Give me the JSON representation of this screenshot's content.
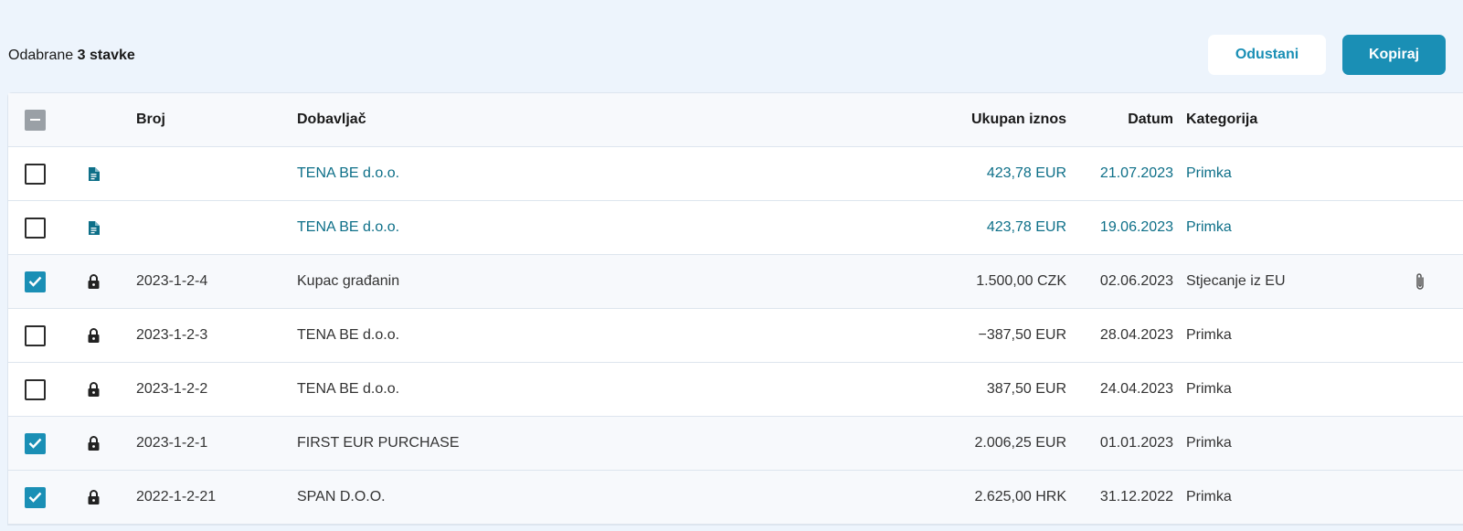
{
  "selection": {
    "prefix": "Odabrane",
    "count_label": "3 stavke"
  },
  "actions": {
    "cancel_label": "Odustani",
    "copy_label": "Kopiraj"
  },
  "colors": {
    "accent": "#1a8fb5",
    "link": "#0d6f88",
    "background": "#edf4fc"
  },
  "table": {
    "header_checkbox_state": "indeterminate",
    "columns": {
      "broj": "Broj",
      "dobavljac": "Dobavljač",
      "iznos": "Ukupan iznos",
      "datum": "Datum",
      "kategorija": "Kategorija"
    },
    "rows": [
      {
        "checked": false,
        "icon": "document-icon",
        "broj": "",
        "dobavljac": "TENA BE d.o.o.",
        "iznos": "423,78 EUR",
        "datum": "21.07.2023",
        "kategorija": "Primka",
        "draft": true,
        "attachment": false
      },
      {
        "checked": false,
        "icon": "document-icon",
        "broj": "",
        "dobavljac": "TENA BE d.o.o.",
        "iznos": "423,78 EUR",
        "datum": "19.06.2023",
        "kategorija": "Primka",
        "draft": true,
        "attachment": false
      },
      {
        "checked": true,
        "icon": "lock-icon",
        "broj": "2023-1-2-4",
        "dobavljac": "Kupac građanin",
        "iznos": "1.500,00 CZK",
        "datum": "02.06.2023",
        "kategorija": "Stjecanje iz EU",
        "draft": false,
        "attachment": true
      },
      {
        "checked": false,
        "icon": "lock-icon",
        "broj": "2023-1-2-3",
        "dobavljac": "TENA BE d.o.o.",
        "iznos": "−387,50 EUR",
        "datum": "28.04.2023",
        "kategorija": "Primka",
        "draft": false,
        "attachment": false
      },
      {
        "checked": false,
        "icon": "lock-icon",
        "broj": "2023-1-2-2",
        "dobavljac": "TENA BE d.o.o.",
        "iznos": "387,50 EUR",
        "datum": "24.04.2023",
        "kategorija": "Primka",
        "draft": false,
        "attachment": false
      },
      {
        "checked": true,
        "icon": "lock-icon",
        "broj": "2023-1-2-1",
        "dobavljac": "FIRST EUR PURCHASE",
        "iznos": "2.006,25 EUR",
        "datum": "01.01.2023",
        "kategorija": "Primka",
        "draft": false,
        "attachment": false
      },
      {
        "checked": true,
        "icon": "lock-icon",
        "broj": "2022-1-2-21",
        "dobavljac": "SPAN D.O.O.",
        "iznos": "2.625,00 HRK",
        "datum": "31.12.2022",
        "kategorija": "Primka",
        "draft": false,
        "attachment": false
      }
    ]
  }
}
